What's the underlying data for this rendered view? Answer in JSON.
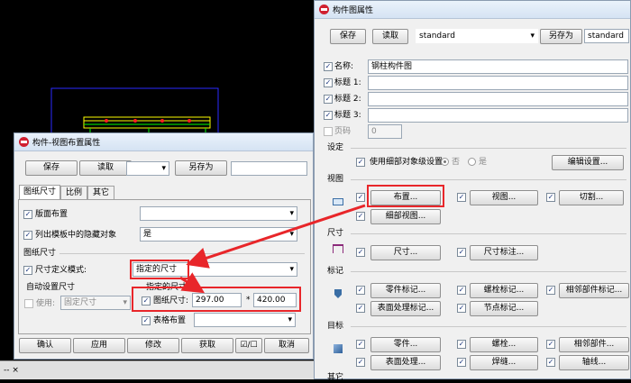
{
  "cad_status_text": "-- ×",
  "layout_dialog": {
    "title": "构件-视图布置属性",
    "save": "保存",
    "load": "读取",
    "save_as": "另存为",
    "tabs": [
      "图纸尺寸",
      "比例",
      "其它"
    ],
    "sheet_layout_label": "版面布置",
    "list_hidden_label": "列出模板中的隐藏对象",
    "list_hidden_value": "是",
    "paper_size_group": "图纸尺寸",
    "size_mode_label": "尺寸定义模式:",
    "size_mode_value": "指定的尺寸",
    "auto_size_group": "自动设置尺寸",
    "use_label": "使用:",
    "fixed_size_value": "固定尺寸",
    "specified_size_group": "指定的尺寸",
    "paper_size_label": "图纸尺寸:",
    "width_value": "297.00",
    "times_sign": "*",
    "height_value": "420.00",
    "table_layout_label": "表格布置",
    "ok": "确认",
    "apply": "应用",
    "modify": "修改",
    "get": "获取",
    "toggle": "☑/☐",
    "cancel": "取消"
  },
  "drawing_dialog": {
    "title": "构件图属性",
    "save": "保存",
    "load": "读取",
    "preset_value": "standard",
    "save_as": "另存为",
    "save_as_value": "standard",
    "name_label": "名称:",
    "name_value": "钢柱构件图",
    "title1_label": "标题 1:",
    "title2_label": "标题 2:",
    "title3_label": "标题 3:",
    "page_label": "页码",
    "page_value": "0",
    "settings_group": "设定",
    "use_detail_label": "使用细部对象级设置",
    "no_label": "否",
    "yes_label": "是",
    "edit_settings": "编辑设置...",
    "view_group": "视图",
    "layout_btn": "布置...",
    "view_btn": "视图...",
    "cut_btn": "切割...",
    "detail_view_btn": "细部视图...",
    "dim_group": "尺寸",
    "dim_btn": "尺寸...",
    "dim_mark_btn": "尺寸标注...",
    "mark_group": "标记",
    "part_mark_btn": "零件标记...",
    "bolt_mark_btn": "螺栓标记...",
    "neighbor_mark_btn": "相邻部件标记...",
    "surface_mark_btn": "表面处理标记...",
    "node_mark_btn": "节点标记...",
    "object_group": "目标",
    "part_btn": "零件...",
    "bolt_btn": "螺栓...",
    "neighbor_btn": "相邻部件...",
    "surface_btn": "表面处理...",
    "weld_btn": "焊缝...",
    "axis_btn": "轴线...",
    "other_group": "其它"
  },
  "colors": {
    "highlight": "#e8262a",
    "cad_frame": "#1a1aff",
    "cad_part": "#ffff00"
  }
}
